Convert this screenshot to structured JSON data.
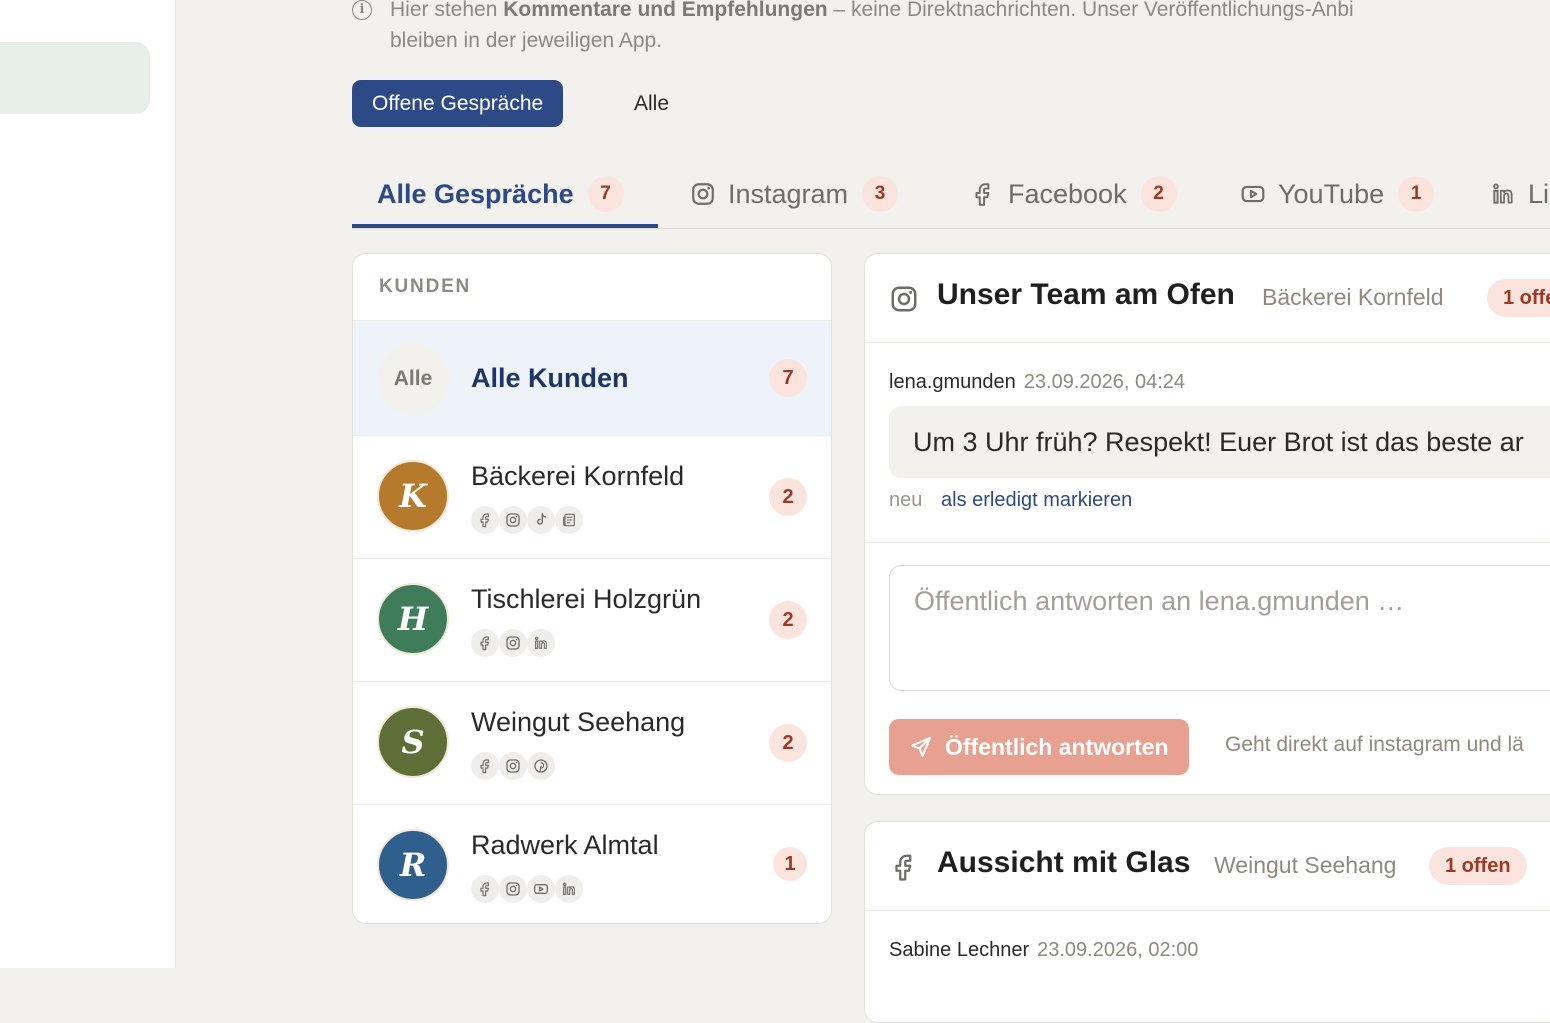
{
  "info": {
    "prefix": "Hier stehen ",
    "bold": "Kommentare und Empfehlungen",
    "suffix": " – keine Direktnachrichten. Unser Veröffentlichungs-Anbi",
    "line2": "bleiben in der jeweiligen App."
  },
  "filters": {
    "open_label": "Offene Gespräche",
    "all_label": "Alle"
  },
  "tabs": [
    {
      "label": "Alle Gespräche",
      "count": "7",
      "icon": "none"
    },
    {
      "label": "Instagram",
      "count": "3",
      "icon": "instagram-icon"
    },
    {
      "label": "Facebook",
      "count": "2",
      "icon": "facebook-icon"
    },
    {
      "label": "YouTube",
      "count": "1",
      "icon": "youtube-icon"
    },
    {
      "label": "Li",
      "count": "",
      "icon": "linkedin-icon"
    }
  ],
  "customers": {
    "header": "KUNDEN",
    "items": [
      {
        "initial": "Alle",
        "name": "Alle Kunden",
        "count": "7",
        "color": "#f2f1ed",
        "platforms": []
      },
      {
        "initial": "K",
        "name": "Bäckerei Kornfeld",
        "count": "2",
        "color": "#b57a2c",
        "platforms": [
          "facebook-icon",
          "instagram-icon",
          "tiktok-icon",
          "news-icon"
        ]
      },
      {
        "initial": "H",
        "name": "Tischlerei Holzgrün",
        "count": "2",
        "color": "#3f7d5a",
        "platforms": [
          "facebook-icon",
          "instagram-icon",
          "linkedin-icon"
        ]
      },
      {
        "initial": "S",
        "name": "Weingut Seehang",
        "count": "2",
        "color": "#5e6e37",
        "platforms": [
          "facebook-icon",
          "instagram-icon",
          "pinterest-icon"
        ]
      },
      {
        "initial": "R",
        "name": "Radwerk Almtal",
        "count": "1",
        "color": "#2f5f8c",
        "platforms": [
          "facebook-icon",
          "instagram-icon",
          "youtube-icon",
          "linkedin-icon"
        ]
      }
    ]
  },
  "threads": [
    {
      "title": "Unser Team am Ofen",
      "customer": "Bäckerei Kornfeld",
      "badge": "1 offe",
      "author": "lena.gmunden",
      "time": "23.09.2026, 04:24",
      "message": "Um 3 Uhr früh? Respekt! Euer Brot ist das beste ar",
      "status": "neu",
      "mark_done": "als erledigt markieren",
      "reply_placeholder": "Öffentlich antworten an lena.gmunden …",
      "reply_button": "Öffentlich antworten",
      "reply_hint": "Geht direkt auf instagram und lä"
    },
    {
      "title": "Aussicht mit Glas",
      "customer": "Weingut Seehang",
      "badge": "1 offen",
      "author": "Sabine Lechner",
      "time": "23.09.2026, 02:00"
    }
  ],
  "colors": {
    "primary": "#2e4a86",
    "badge_bg": "#fbe4de",
    "badge_text": "#9c3b24",
    "reply_button": "#e8a090",
    "sidebar_active": "#e7efe8"
  }
}
